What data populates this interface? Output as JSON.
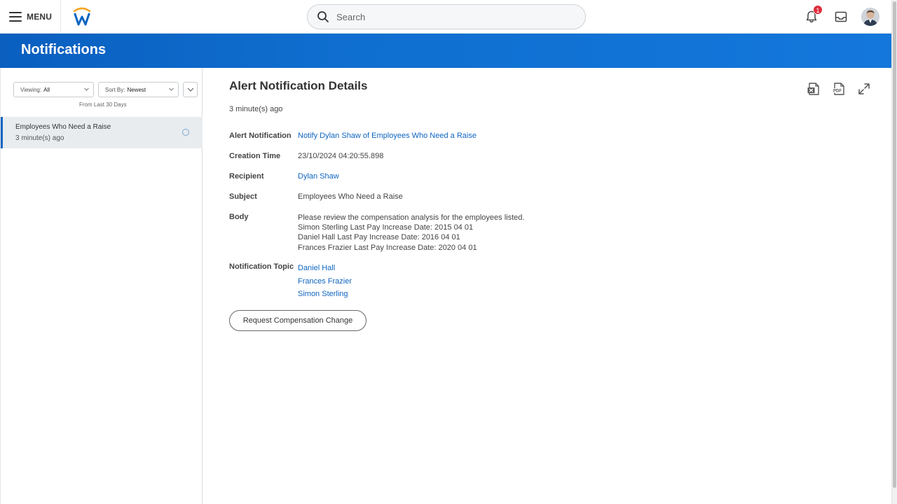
{
  "header": {
    "menu_label": "MENU",
    "search_placeholder": "Search",
    "notification_count": "1",
    "logo_icon": "workday-logo-icon",
    "icons": [
      "hamburger-icon",
      "search-icon",
      "bell-icon",
      "inbox-icon",
      "avatar"
    ]
  },
  "banner": {
    "title": "Notifications",
    "color": "#0f6fd0"
  },
  "filters": {
    "viewing_label": "Viewing:",
    "viewing_value": "All",
    "sort_label": "Sort By:",
    "sort_value": "Newest",
    "range_text": "From Last 30 Days"
  },
  "list": {
    "items": [
      {
        "title": "Employees Who Need a Raise",
        "time": "3 minute(s) ago"
      }
    ]
  },
  "detail": {
    "title": "Alert Notification Details",
    "time": "3 minute(s) ago",
    "tools": [
      "export-excel-icon",
      "export-pdf-icon",
      "fullscreen-icon"
    ],
    "fields": {
      "alert_notification_label": "Alert Notification",
      "alert_notification_value": "Notify Dylan Shaw of Employees Who Need a Raise",
      "creation_time_label": "Creation Time",
      "creation_time_value": "23/10/2024 04:20:55.898",
      "recipient_label": "Recipient",
      "recipient_value": "Dylan Shaw",
      "subject_label": "Subject",
      "subject_value": "Employees Who Need a Raise",
      "body_label": "Body",
      "body_lines": [
        "Please review the compensation analysis for the employees listed.",
        "Simon Sterling Last Pay Increase Date: 2015 04 01",
        "Daniel Hall Last Pay Increase Date: 2016 04 01",
        "Frances Frazier Last Pay Increase Date: 2020 04 01"
      ],
      "topic_label": "Notification Topic",
      "topics": [
        "Daniel Hall",
        "Frances Frazier",
        "Simon Sterling"
      ]
    },
    "action_button": "Request Compensation Change"
  }
}
